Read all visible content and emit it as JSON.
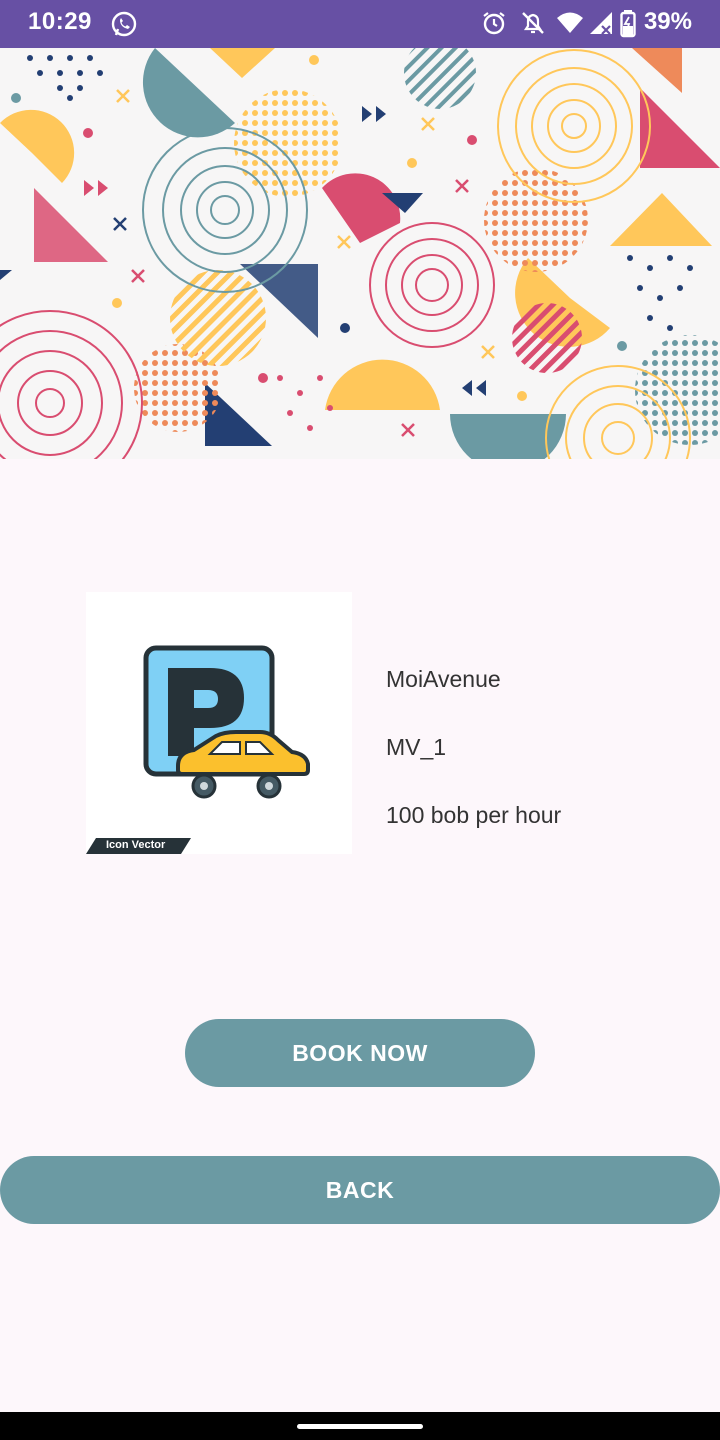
{
  "status_bar": {
    "time": "10:29",
    "battery": "39%",
    "icons": [
      "whatsapp-icon",
      "alarm-icon",
      "notifications-off-icon",
      "wifi-icon",
      "signal-icon",
      "battery-icon"
    ],
    "color": "#6750a4"
  },
  "banner": {
    "description_icon": "abstract-geometric-pattern"
  },
  "listing": {
    "logo_badge": "Icon Vector",
    "name": "MoiAvenue",
    "code": "MV_1",
    "rate": "100 bob per hour"
  },
  "actions": {
    "book_label": "BOOK NOW",
    "back_label": "BACK",
    "button_color": "#6b9aa3"
  }
}
